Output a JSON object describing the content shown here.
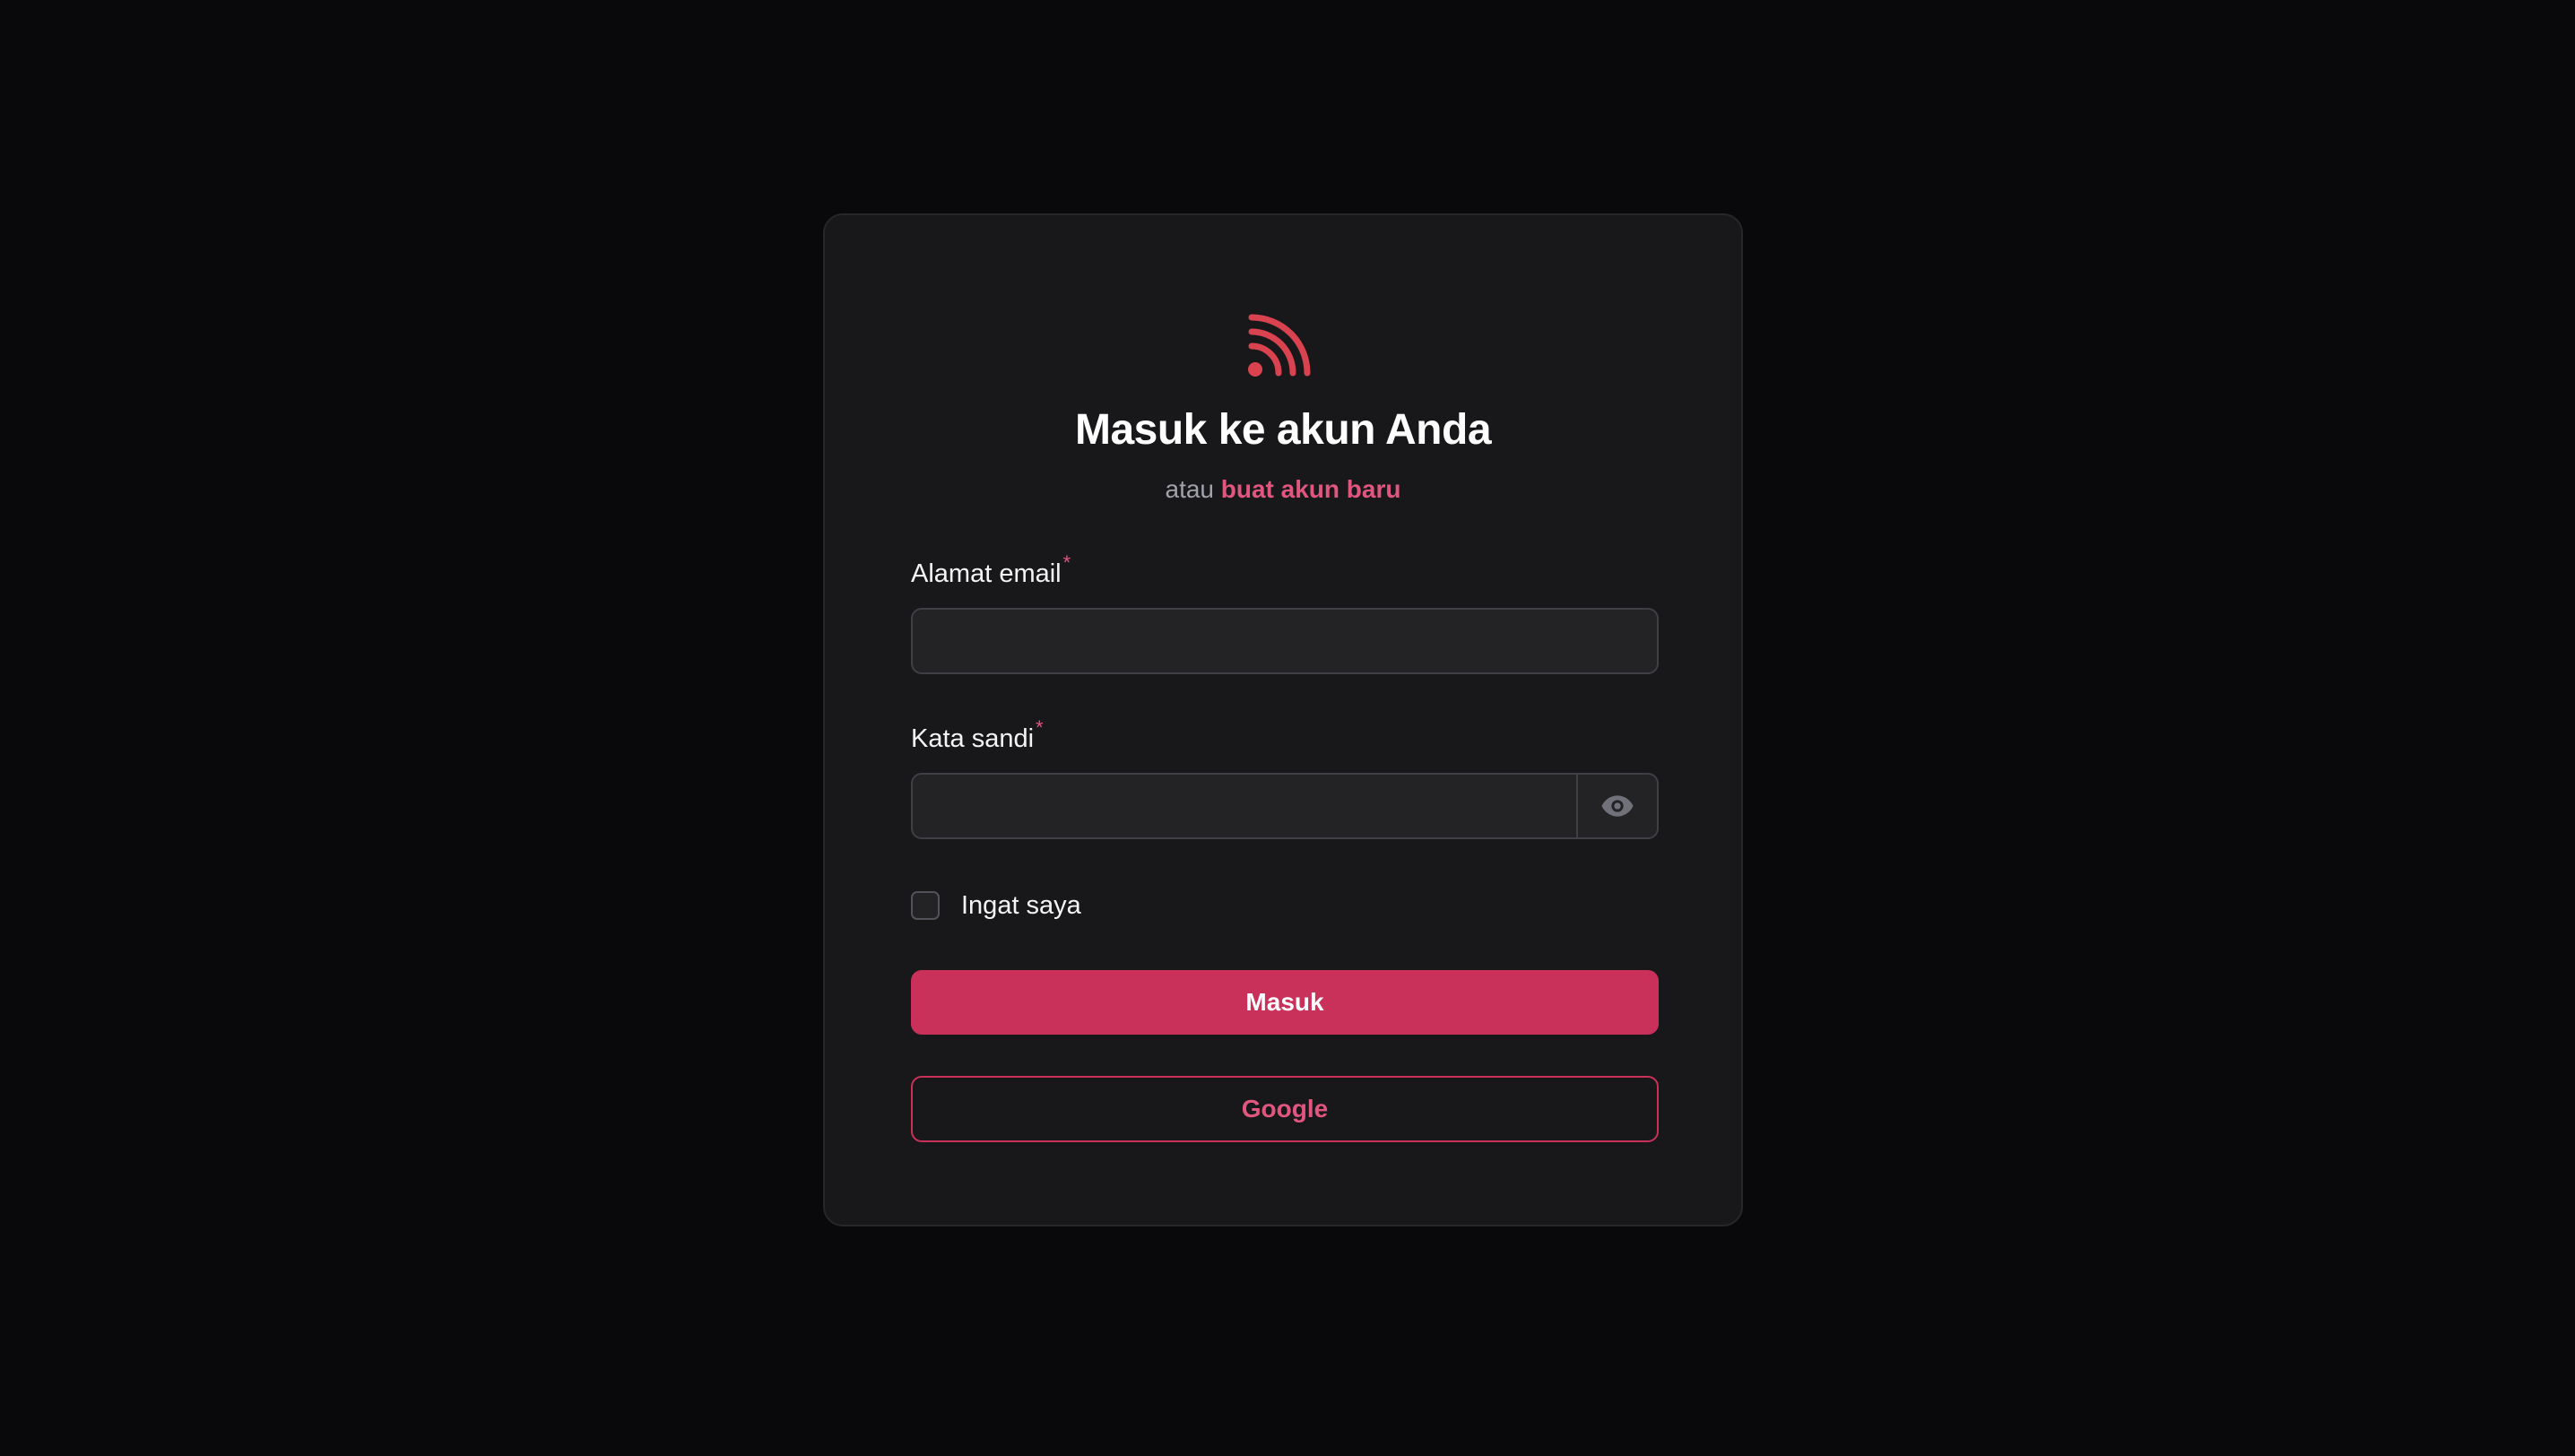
{
  "brand": {
    "logo_icon": "rss-feed-icon",
    "accent_color": "#c9305a"
  },
  "header": {
    "title": "Masuk ke akun Anda",
    "subtitle_prefix": "atau",
    "register_link": "buat akun baru"
  },
  "form": {
    "email": {
      "label": "Alamat email",
      "required_mark": "*",
      "value": ""
    },
    "password": {
      "label": "Kata sandi",
      "required_mark": "*",
      "value": "",
      "toggle_icon": "eye-icon"
    },
    "remember": {
      "label": "Ingat saya",
      "checked": false
    },
    "submit_label": "Masuk",
    "google_label": "Google"
  }
}
